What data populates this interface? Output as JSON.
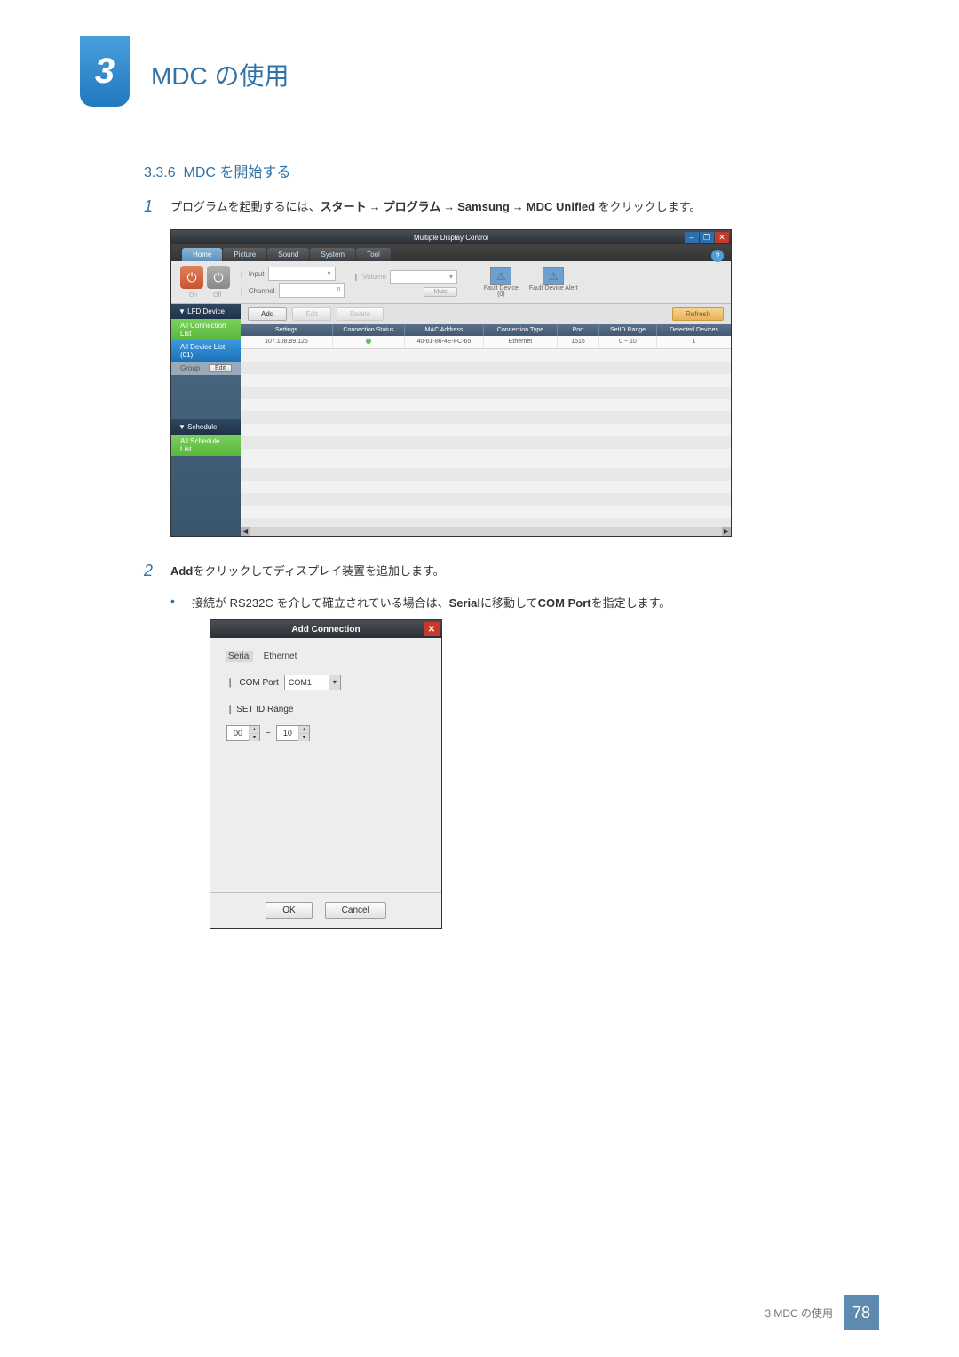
{
  "chapter": {
    "number": "3",
    "title": "MDC の使用"
  },
  "section": {
    "number": "3.3.6",
    "title": "MDC を開始する"
  },
  "steps": {
    "s1": {
      "num": "1",
      "pre": "プログラムを起動するには、",
      "p1": "スタート",
      "p2": "プログラム",
      "p3": "Samsung",
      "p4": "MDC Unified",
      "post": " をクリックします。"
    },
    "s2": {
      "num": "2",
      "pre": "Add",
      "post": "をクリックしてディスプレイ装置を追加します。"
    },
    "b1": {
      "pre": "接続が RS232C を介して確立されている場合は、",
      "m1": "Serial",
      "mid": "に移動して",
      "m2": "COM Port",
      "post": "を指定します。"
    }
  },
  "mdc": {
    "title": "Multiple Display Control",
    "tabs": {
      "home": "Home",
      "picture": "Picture",
      "sound": "Sound",
      "system": "System",
      "tool": "Tool"
    },
    "onoff": {
      "on": "On",
      "off": "Off"
    },
    "input_label": "Input",
    "channel_label": "Channel",
    "volume_label": "Volume",
    "mute": "Mute",
    "fault_device": "Fault Device",
    "fault_n": "(0)",
    "fault_alert": "Fault Device Alert",
    "side": {
      "lfd": "▼ LFD Device",
      "all_conn": "All Connection List",
      "all_dev": "All Device List (01)",
      "group": "Group",
      "edit": "Edit",
      "schedule": "▼ Schedule",
      "all_sched": "All Schedule List"
    },
    "tb": {
      "add": "Add",
      "edit": "Edit",
      "delete": "Delete",
      "refresh": "Refresh"
    },
    "columns": {
      "settings": "Settings",
      "cs": "Connection Status",
      "mac": "MAC Address",
      "ct": "Connection Type",
      "port": "Port",
      "sid": "SetID Range",
      "dd": "Detected Devices"
    },
    "row": {
      "settings": "107.108.89.126",
      "mac": "40-61-86-4E-FC-65",
      "ct": "Ethernet",
      "port": "1515",
      "sid": "0 ~ 10",
      "dd": "1"
    }
  },
  "dlg": {
    "title": "Add Connection",
    "tabs": {
      "serial": "Serial",
      "eth": "Ethernet"
    },
    "com_label": "COM Port",
    "com_value": "COM1",
    "range_label": "SET ID Range",
    "from": "00",
    "to": "10",
    "ok": "OK",
    "cancel": "Cancel"
  },
  "footer": {
    "label": "3 MDC の使用",
    "page": "78"
  },
  "glyph": {
    "arrow": "→",
    "help": "?",
    "caret": "▾",
    "tilde": "~",
    "dash": "–",
    "box": "❐",
    "x": "✕",
    "up": "▴",
    "down": "▾",
    "pwr": "⏻",
    "warn": "⚠",
    "bar": "❙",
    "left": "◀",
    "right": "▶"
  }
}
